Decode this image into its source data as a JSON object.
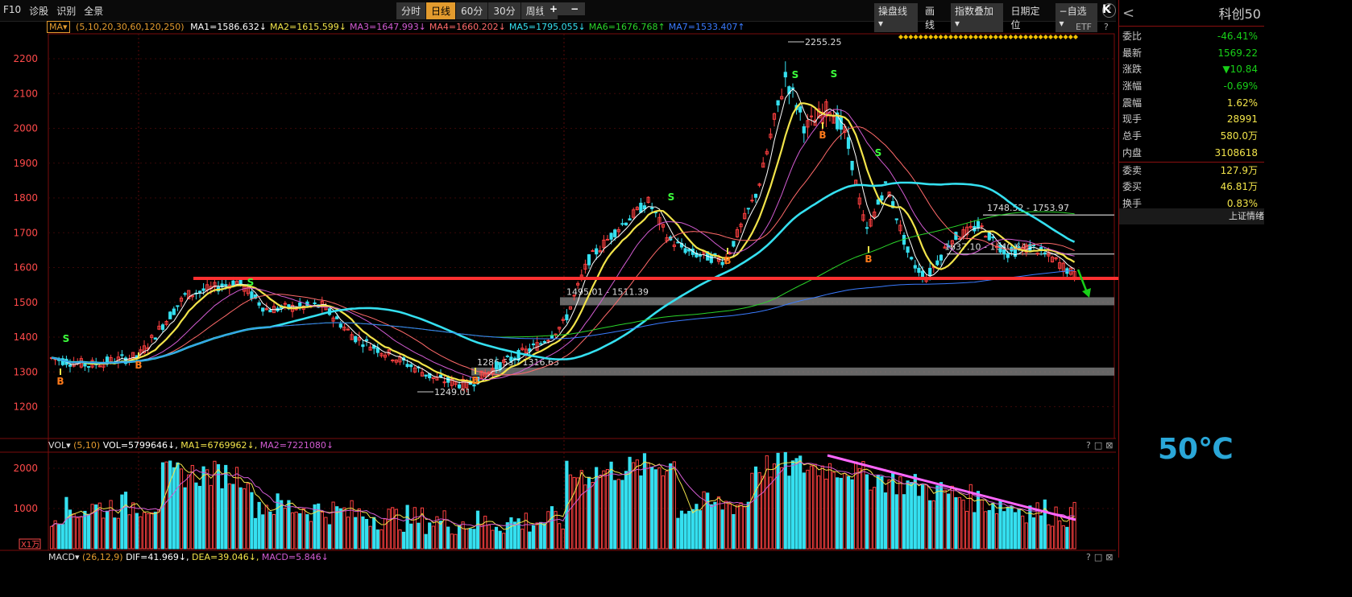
{
  "toolbar": {
    "left_items": [
      "F10",
      "诊股",
      "识别",
      "全景"
    ],
    "periods": [
      "分时",
      "日线",
      "60分",
      "30分",
      "周线 ▾"
    ],
    "active_period": "日线",
    "zoom_in": "+",
    "zoom_out": "−",
    "right_items": [
      "操盘线 ▾",
      "画线",
      "指数叠加 ▾",
      "日期定位",
      "−自选 ▾"
    ],
    "help": "?"
  },
  "ma_legend": {
    "button": "MA▾",
    "params": "(5,10,20,30,60,120,250)",
    "items": [
      {
        "text": "MA1=1586.632↓",
        "color": "#ffffff"
      },
      {
        "text": "MA2=1615.599↓",
        "color": "#f2e44a"
      },
      {
        "text": "MA3=1647.993↓",
        "color": "#d35cd3"
      },
      {
        "text": "MA4=1660.202↓",
        "color": "#ff6a6a"
      },
      {
        "text": "MA5=1795.055↓",
        "color": "#35e0f0"
      },
      {
        "text": "MA6=1676.768↑",
        "color": "#2ad52a"
      },
      {
        "text": "MA7=1533.407↑",
        "color": "#3a7bff"
      }
    ],
    "etf": "ETF",
    "qm": "?"
  },
  "price_axis": {
    "ticks": [
      "2200",
      "2100",
      "2000",
      "1900",
      "1800",
      "1700",
      "1600",
      "1500",
      "1400",
      "1300",
      "1200"
    ],
    "values": [
      2200,
      2100,
      2000,
      1900,
      1800,
      1700,
      1600,
      1500,
      1400,
      1300,
      1200
    ]
  },
  "annotations": {
    "high": "2255.25",
    "low": "1249.01",
    "zone_1": "1286.53 - 1316.63",
    "zone_2": "1495.01 - 1511.39",
    "zone_3": "1748.52 - 1753.97",
    "zone_4": "1637.10 - 1640.64"
  },
  "signals": {
    "buy": "B",
    "sell": "S"
  },
  "vol_legend": {
    "prefix": "VOL▾",
    "params": "(5,10)",
    "vol": "VOL=5799646↓,",
    "ma1": "MA1=6769962↓,",
    "ma2": "MA2=7221080↓"
  },
  "vol_axis": {
    "ticks": [
      "2000",
      "1000"
    ],
    "unit": "X1万"
  },
  "macd_legend": {
    "prefix": "MACD▾",
    "params": "(26,12,9)",
    "dif": "DIF=41.969↓,",
    "dea": "DEA=39.046↓,",
    "macd": "MACD=5.846↓"
  },
  "panel_controls": [
    "?",
    "□",
    "⊠"
  ],
  "side": {
    "back": "<",
    "title": "科创50",
    "rows": [
      {
        "k": "委比",
        "v": "-46.41%",
        "c": "green"
      },
      {
        "k": "最新",
        "v": "1569.22",
        "c": "green"
      },
      {
        "k": "涨跌",
        "v": "▼10.84",
        "c": "green"
      },
      {
        "k": "涨幅",
        "v": "-0.69%",
        "c": "green"
      },
      {
        "k": "震幅",
        "v": "1.62%",
        "c": "yellow"
      },
      {
        "k": "现手",
        "v": "28991",
        "c": "yellow"
      },
      {
        "k": "总手",
        "v": "580.0万",
        "c": "yellow"
      },
      {
        "k": "内盘",
        "v": "3108618",
        "c": "yellow"
      },
      {
        "k": "委卖",
        "v": "127.9万",
        "c": "yellow"
      },
      {
        "k": "委买",
        "v": "46.81万",
        "c": "yellow"
      },
      {
        "k": "换手",
        "v": "0.83%",
        "c": "yellow"
      }
    ],
    "tab": "上证情绪",
    "temperature": "50℃"
  },
  "colors": {
    "up": "#ff4040",
    "down": "#35e0f0",
    "support_line": "#ff3030",
    "zone": "#888888",
    "accent": "#e39b2e"
  }
}
